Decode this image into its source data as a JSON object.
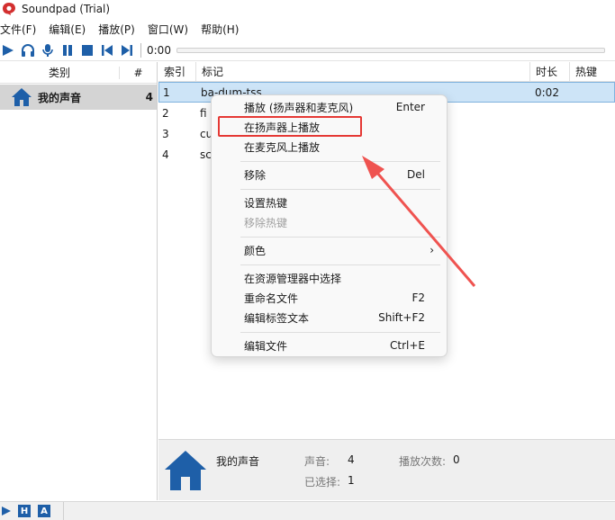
{
  "window": {
    "title": "Soundpad (Trial)"
  },
  "menu": [
    "文件(F)",
    "编辑(E)",
    "播放(P)",
    "窗口(W)",
    "帮助(H)"
  ],
  "toolbar": {
    "time": "0:00"
  },
  "categories": {
    "header_name": "类别",
    "header_count": "#",
    "items": [
      {
        "name": "我的声音",
        "count": "4"
      }
    ]
  },
  "sounds": {
    "headers": {
      "index": "索引",
      "tag": "标记",
      "duration": "时长",
      "hotkey": "热键"
    },
    "rows": [
      {
        "index": "1",
        "tag": "ba-dum-tss",
        "duration": "0:02"
      },
      {
        "index": "2",
        "tag": "fi",
        "duration": ""
      },
      {
        "index": "3",
        "tag": "cu",
        "duration": ""
      },
      {
        "index": "4",
        "tag": "sc",
        "duration": ""
      }
    ]
  },
  "info": {
    "category": "我的声音",
    "sounds_label": "声音:",
    "sounds_value": "4",
    "plays_label": "播放次数:",
    "plays_value": "0",
    "selected_label": "已选择:",
    "selected_value": "1"
  },
  "statusbar": {
    "badge1": "H",
    "badge2": "A"
  },
  "context_menu": {
    "items": [
      {
        "label": "播放 (扬声器和麦克风)",
        "shortcut": "Enter"
      },
      {
        "label": "在扬声器上播放",
        "shortcut": ""
      },
      {
        "label": "在麦克风上播放",
        "shortcut": ""
      },
      {
        "label": "移除",
        "shortcut": "Del"
      },
      {
        "label": "设置热键",
        "shortcut": ""
      },
      {
        "label": "移除热键",
        "shortcut": ""
      },
      {
        "label": "颜色",
        "shortcut": ""
      },
      {
        "label": "在资源管理器中选择",
        "shortcut": ""
      },
      {
        "label": "重命名文件",
        "shortcut": "F2"
      },
      {
        "label": "编辑标签文本",
        "shortcut": "Shift+F2"
      },
      {
        "label": "编辑文件",
        "shortcut": "Ctrl+E"
      }
    ]
  },
  "colors": {
    "accent": "#1e5fa8",
    "selection": "#cde4f7",
    "annotation": "#e53935"
  }
}
